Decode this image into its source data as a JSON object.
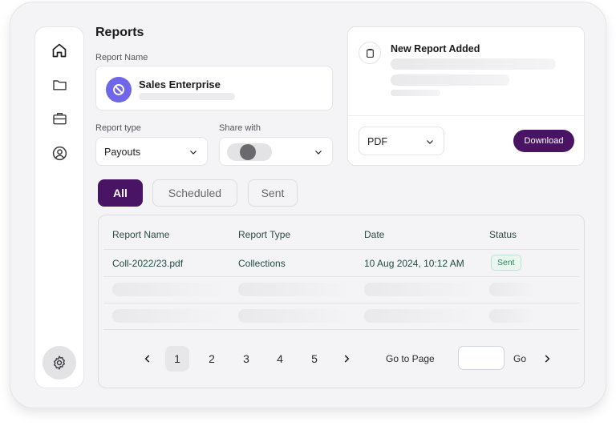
{
  "page": {
    "title": "Reports"
  },
  "sidebar": {
    "items": [
      {
        "name": "home",
        "icon": "home-icon"
      },
      {
        "name": "folders",
        "icon": "folder-icon"
      },
      {
        "name": "work",
        "icon": "briefcase-icon"
      },
      {
        "name": "profile",
        "icon": "user-circle-icon"
      }
    ],
    "settings_icon": "gear-icon"
  },
  "report_name": {
    "label": "Report Name",
    "value": "Sales Enterprise"
  },
  "report_type": {
    "label": "Report type",
    "value": "Payouts"
  },
  "share_with": {
    "label": "Share with"
  },
  "notification": {
    "title": "New Report Added",
    "icon": "clipboard-icon"
  },
  "format_select": {
    "value": "PDF"
  },
  "download": {
    "label": "Download"
  },
  "filters": {
    "all": "All",
    "scheduled": "Scheduled",
    "sent": "Sent",
    "active": "All"
  },
  "table": {
    "columns": [
      "Report Name",
      "Report Type",
      "Date",
      "Status"
    ],
    "rows": [
      {
        "name": "Coll-2022/23.pdf",
        "type": "Collections",
        "date": "10 Aug 2024, 10:12 AM",
        "status": "Sent"
      }
    ]
  },
  "pagination": {
    "pages": [
      "1",
      "2",
      "3",
      "4",
      "5"
    ],
    "current": "1",
    "goto_label": "Go to Page",
    "go_label": "Go",
    "goto_value": ""
  },
  "colors": {
    "accent": "#4a1464",
    "logo": "#6f66e8",
    "status_sent": "#1f8a5a"
  }
}
